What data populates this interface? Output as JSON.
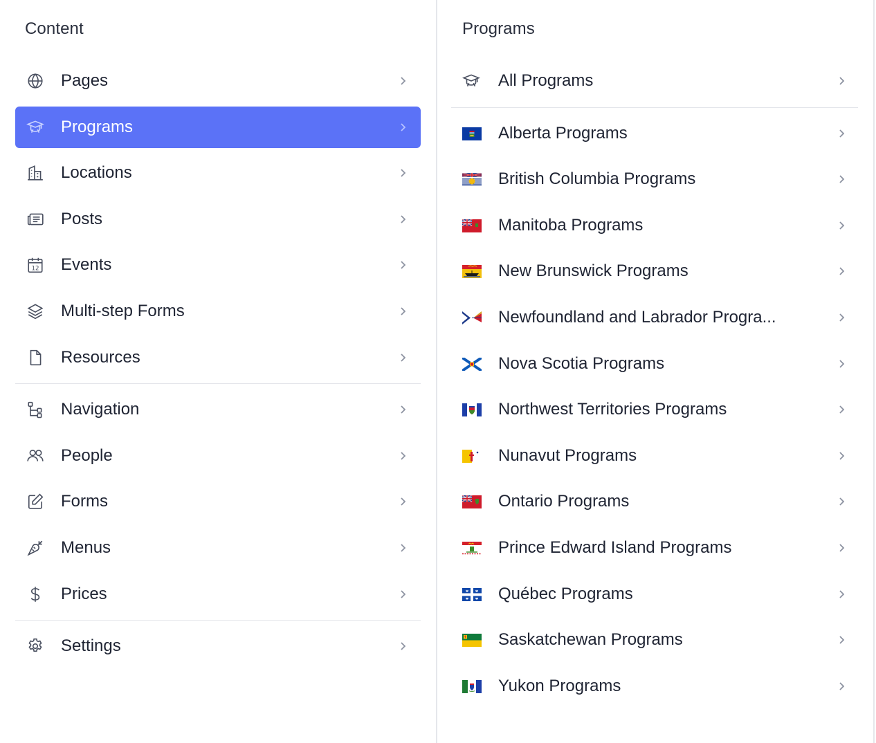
{
  "left": {
    "title": "Content",
    "items": [
      {
        "label": "Pages",
        "icon": "globe-icon"
      },
      {
        "label": "Programs",
        "icon": "graduation-cap-icon",
        "active": true
      },
      {
        "label": "Locations",
        "icon": "building-icon"
      },
      {
        "label": "Posts",
        "icon": "newspaper-icon"
      },
      {
        "label": "Events",
        "icon": "calendar-icon",
        "icon_text": "12"
      },
      {
        "label": "Multi-step Forms",
        "icon": "layers-icon"
      },
      {
        "label": "Resources",
        "icon": "file-icon"
      },
      {
        "label": "Navigation",
        "icon": "sitemap-icon"
      },
      {
        "label": "People",
        "icon": "users-icon"
      },
      {
        "label": "Forms",
        "icon": "edit-icon"
      },
      {
        "label": "Menus",
        "icon": "carrot-icon"
      },
      {
        "label": "Prices",
        "icon": "dollar-icon"
      },
      {
        "label": "Settings",
        "icon": "gear-icon"
      }
    ]
  },
  "right": {
    "title": "Programs",
    "items": [
      {
        "label": "All Programs",
        "icon": "graduation-cap-icon"
      },
      {
        "label": "Alberta Programs",
        "icon": "alberta-flag-icon"
      },
      {
        "label": "British Columbia Programs",
        "icon": "british-columbia-flag-icon"
      },
      {
        "label": "Manitoba Programs",
        "icon": "manitoba-flag-icon"
      },
      {
        "label": "New Brunswick Programs",
        "icon": "new-brunswick-flag-icon"
      },
      {
        "label": "Newfoundland and Labrador Progra...",
        "icon": "newfoundland-flag-icon"
      },
      {
        "label": "Nova Scotia Programs",
        "icon": "nova-scotia-flag-icon"
      },
      {
        "label": "Northwest Territories Programs",
        "icon": "northwest-territories-flag-icon"
      },
      {
        "label": "Nunavut Programs",
        "icon": "nunavut-flag-icon"
      },
      {
        "label": "Ontario Programs",
        "icon": "ontario-flag-icon"
      },
      {
        "label": "Prince Edward Island Programs",
        "icon": "pei-flag-icon"
      },
      {
        "label": "Québec Programs",
        "icon": "quebec-flag-icon"
      },
      {
        "label": "Saskatchewan Programs",
        "icon": "saskatchewan-flag-icon"
      },
      {
        "label": "Yukon Programs",
        "icon": "yukon-flag-icon"
      }
    ]
  },
  "colors": {
    "accent": "#5b72f7",
    "text": "#1f2433",
    "chevron": "#8d93a1",
    "divider": "#e3e5ea"
  }
}
